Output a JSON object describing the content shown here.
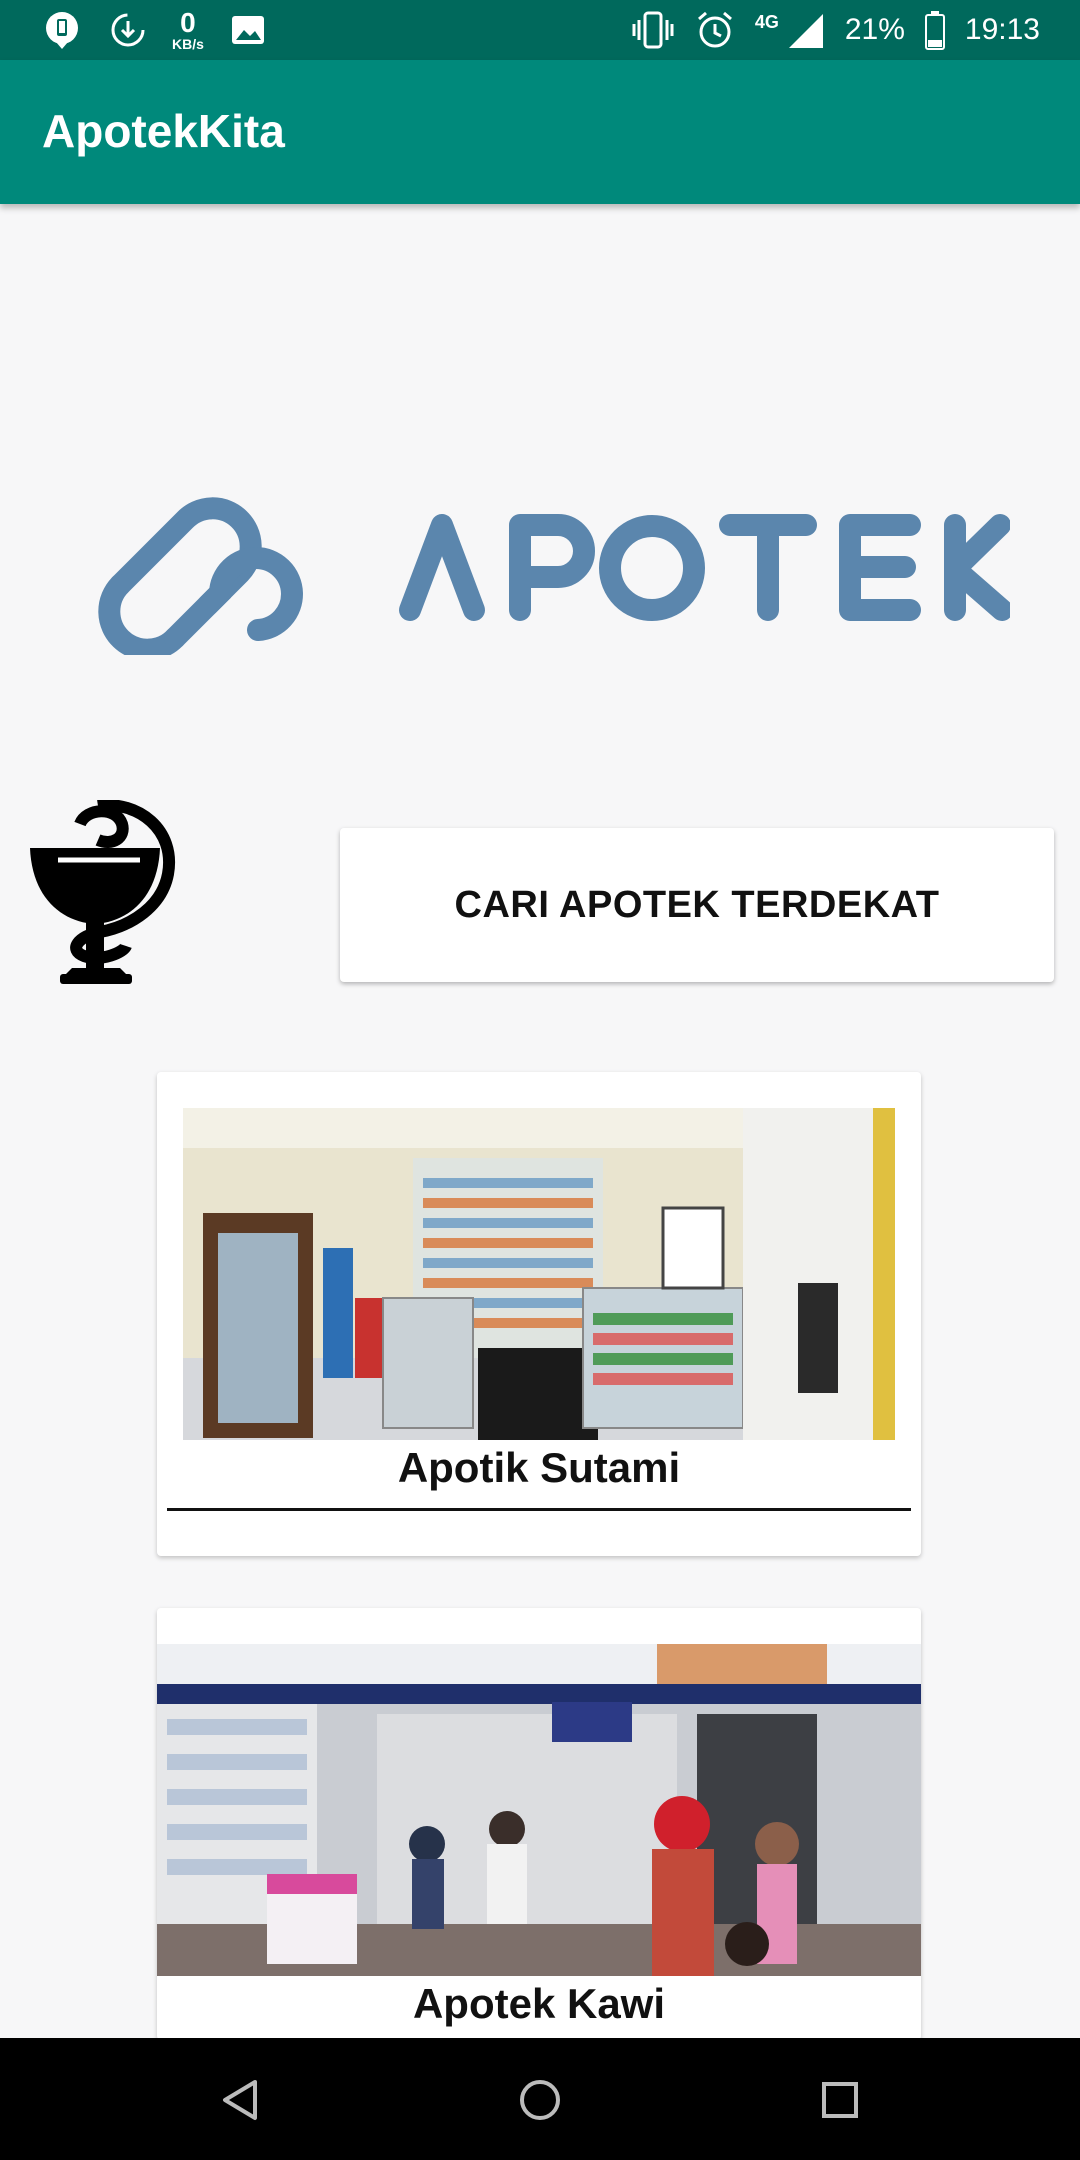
{
  "status_bar": {
    "speed_value": "0",
    "speed_unit": "KB/s",
    "battery": "21%",
    "time": "19:13",
    "network": "4G",
    "icons": [
      "notification-icon",
      "download-icon",
      "image-icon",
      "vibrate-icon",
      "alarm-icon",
      "signal-icon",
      "battery-icon"
    ]
  },
  "app_bar": {
    "title": "ApotekKita"
  },
  "logo": {
    "text": "APOTEK"
  },
  "search_button": {
    "label": "CARI APOTEK TERDEKAT"
  },
  "pharmacies": [
    {
      "name": "Apotik Sutami"
    },
    {
      "name": "Apotek Kawi"
    }
  ],
  "nav": {
    "icons": [
      "back-icon",
      "home-icon",
      "recents-icon"
    ]
  },
  "colors": {
    "status_bar": "#00695c",
    "app_bar": "#00897b",
    "logo": "#5b86ad"
  }
}
